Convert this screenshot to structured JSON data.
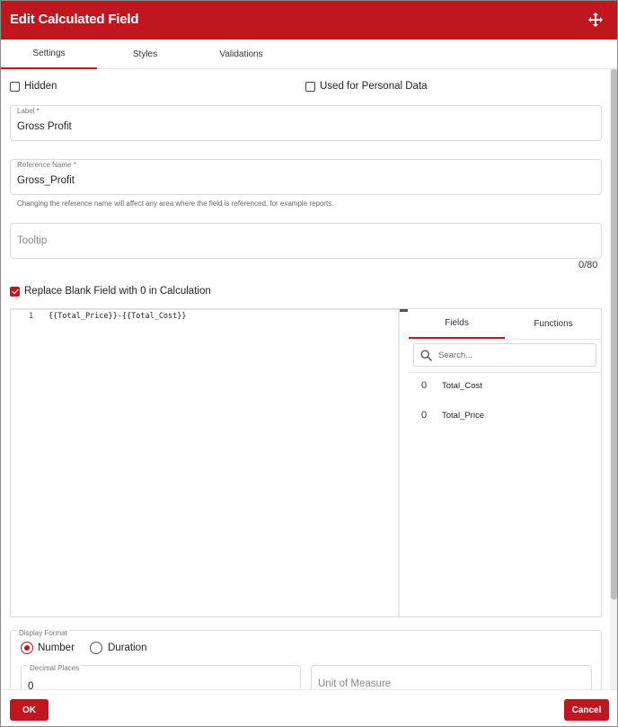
{
  "header": {
    "title": "Edit Calculated Field",
    "move_icon": "move-arrows-icon"
  },
  "tabs": [
    {
      "label": "Settings",
      "active": true
    },
    {
      "label": "Styles",
      "active": false
    },
    {
      "label": "Validations",
      "active": false
    }
  ],
  "settings": {
    "hidden_label": "Hidden",
    "hidden_checked": false,
    "personal_data_label": "Used for Personal Data",
    "personal_data_checked": false,
    "label_field": {
      "label": "Label *",
      "value": "Gross Profit"
    },
    "reference_field": {
      "label": "Reference Name *",
      "value": "Gross_Profit"
    },
    "reference_hint": "Changing the reference name will affect any area where the field is referenced, for example reports.",
    "tooltip_field": {
      "placeholder": "Tooltip",
      "counter": "0/80"
    },
    "replace_blank_label": "Replace Blank Field with 0 in Calculation",
    "replace_blank_checked": true
  },
  "editor": {
    "line_number": "1",
    "code": "{{Total_Price}}-{{Total_Cost}}"
  },
  "side_panel": {
    "tabs": [
      {
        "label": "Fields",
        "active": true
      },
      {
        "label": "Functions",
        "active": false
      }
    ],
    "search_placeholder": "Search...",
    "fields": [
      {
        "type_glyph": "0",
        "name": "Total_Cost"
      },
      {
        "type_glyph": "0",
        "name": "Total_Price"
      }
    ]
  },
  "display_format": {
    "label": "Display Format",
    "options": [
      {
        "label": "Number",
        "selected": true
      },
      {
        "label": "Duration",
        "selected": false
      }
    ],
    "decimal_places": {
      "label": "Decimal Places",
      "value": "0"
    },
    "unit_of_measure": {
      "placeholder": "Unit of Measure"
    }
  },
  "footer": {
    "ok_label": "OK",
    "cancel_label": "Cancel"
  },
  "colors": {
    "accent": "#c0161f"
  }
}
